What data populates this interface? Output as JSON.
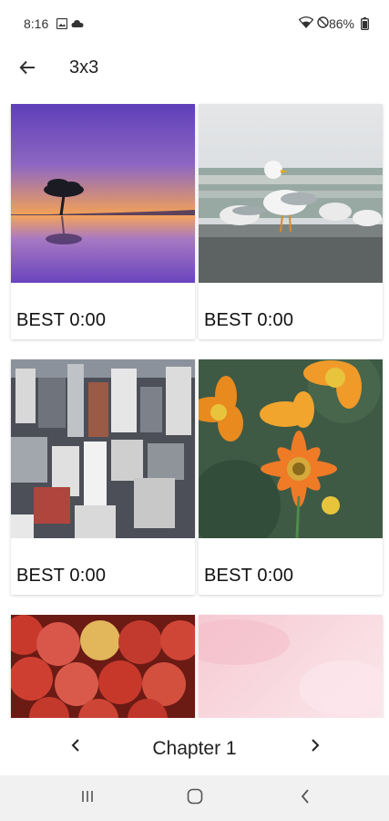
{
  "status_bar": {
    "time": "8:16",
    "battery": "86%",
    "icons": [
      "image-icon",
      "cloud-icon",
      "wifi-icon",
      "do-not-disturb-icon",
      "battery-icon"
    ]
  },
  "app_bar": {
    "title": "3x3",
    "back_icon": "arrow-back-icon"
  },
  "puzzles": [
    {
      "image": "tree-sunset-lake",
      "best_label": "BEST 0:00"
    },
    {
      "image": "seagulls-on-rock",
      "best_label": "BEST 0:00"
    },
    {
      "image": "city-skyline-aerial",
      "best_label": "BEST 0:00"
    },
    {
      "image": "orange-flowers",
      "best_label": "BEST 0:00"
    },
    {
      "image": "red-apples",
      "best_label": ""
    },
    {
      "image": "pink-watercolor",
      "best_label": ""
    }
  ],
  "chapter_nav": {
    "label": "Chapter 1",
    "prev_icon": "chevron-left-icon",
    "next_icon": "chevron-right-icon"
  },
  "system_nav": {
    "buttons": [
      "recents-icon",
      "home-icon",
      "back-icon"
    ]
  },
  "colors": {
    "background": "#ffffff",
    "nav_bar": "#f1f1f1",
    "text": "#1b1b1b"
  }
}
